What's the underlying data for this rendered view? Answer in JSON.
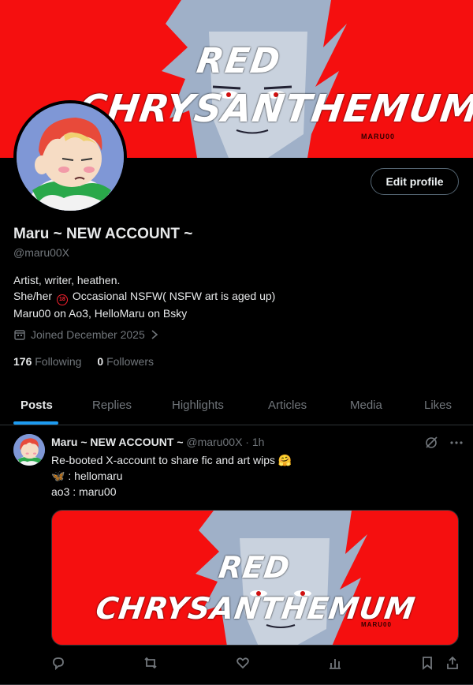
{
  "banner": {
    "title_line1": "RED",
    "title_line2": "CHRYSANTHEMUM",
    "signature": "MARU00"
  },
  "profile": {
    "edit_button": "Edit profile",
    "name": "Maru ~ NEW ACCOUNT ~",
    "handle": "@maru00X",
    "bio_line1": "Artist, writer, heathen.",
    "bio_line2_pre": "She/her",
    "bio_badge": "18",
    "bio_line2_post": "Occasional NSFW( NSFW art is aged up)",
    "bio_line3": "Maru00 on Ao3, HelloMaru on Bsky",
    "joined": "Joined December 2025",
    "following_count": "176",
    "following_label": "Following",
    "followers_count": "0",
    "followers_label": "Followers"
  },
  "tabs": [
    "Posts",
    "Replies",
    "Highlights",
    "Articles",
    "Media",
    "Likes"
  ],
  "post": {
    "author_name": "Maru ~ NEW ACCOUNT ~",
    "meta": "@maru00X · 1h",
    "line1": "Re-booted X-account to share fic and art wips 🤗",
    "line2": "🦋 : hellomaru",
    "line3": "ao3 : maru00",
    "media_title1": "RED",
    "media_title2": "CHRYSANTHEMUM",
    "media_signature": "MARU00"
  },
  "colors": {
    "accent": "#1d9bf0",
    "banner_red": "#f50f0f",
    "muted": "#71767b",
    "border": "#2f3336"
  },
  "icons": [
    "calendar-icon",
    "chevron-right-icon",
    "grok-icon",
    "more-icon",
    "reply-icon",
    "repost-icon",
    "like-icon",
    "views-icon",
    "bookmark-icon",
    "share-icon"
  ]
}
